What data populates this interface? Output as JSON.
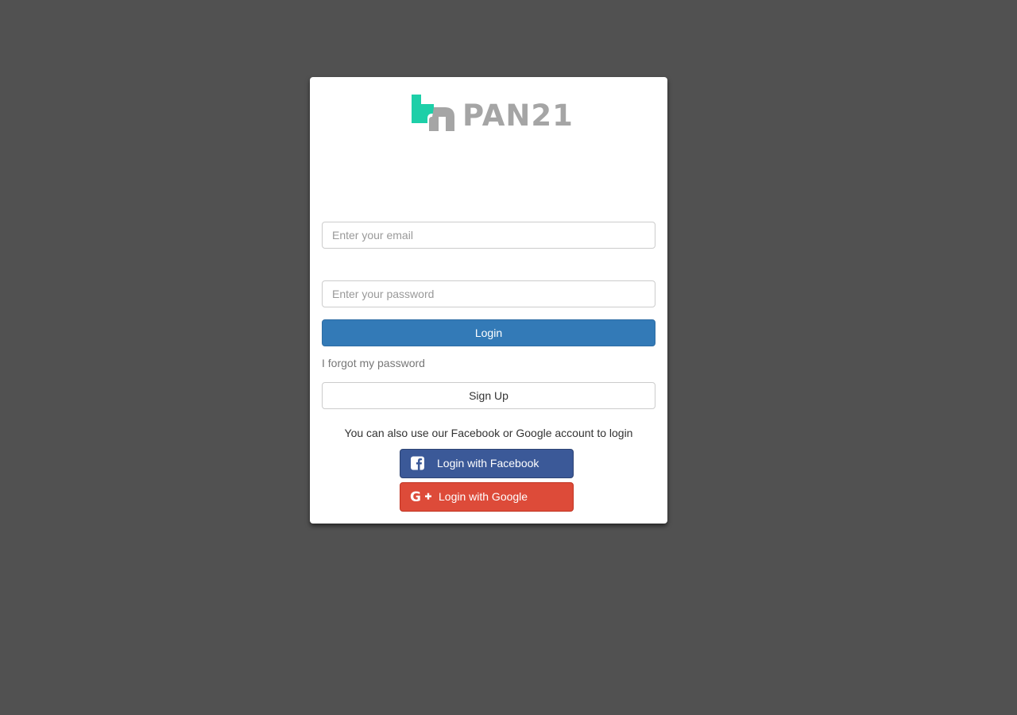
{
  "brand": {
    "name": "PAN21",
    "colors": {
      "mark": "#1dcfa8",
      "text": "#a5a5a5"
    }
  },
  "form": {
    "email_placeholder": "Enter your email",
    "password_placeholder": "Enter your password",
    "login_label": "Login",
    "forgot_label": "I forgot my password",
    "signup_label": "Sign Up"
  },
  "social": {
    "note": "You can also use our Facebook or Google account to login",
    "facebook": {
      "label": "Login with Facebook",
      "icon": "facebook-square-icon",
      "color": "#3b5998"
    },
    "google": {
      "label": "Login with Google",
      "icon": "google-plus-icon",
      "color": "#dd4b39"
    }
  },
  "theme": {
    "primary": "#337ab7",
    "page_background": "#515151"
  }
}
